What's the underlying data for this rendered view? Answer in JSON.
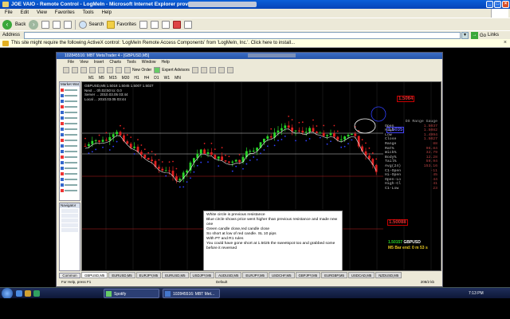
{
  "ie": {
    "title": "JOE VAIO - Remote Control - LogMeIn - Microsoft Internet Explorer provided by",
    "menu": [
      "File",
      "Edit",
      "View",
      "Favorites",
      "Tools",
      "Help"
    ],
    "toolbar": {
      "back": "Back",
      "search": "Search",
      "favorites": "Favorites"
    },
    "address_label": "Address",
    "go_label": "Go",
    "links_label": "Links",
    "infobar": "This site might require the following ActiveX control: 'LogMeIn Remote Access Components' from 'LogMeIn, Inc.'. Click here to install..."
  },
  "mt4": {
    "title": "102845516: MBT MetaTrader 4 - [GBPUSD,M5]",
    "menu": [
      "File",
      "View",
      "Insert",
      "Charts",
      "Tools",
      "Window",
      "Help"
    ],
    "toolbar": {
      "new_order": "New Order",
      "expert_advisors": "Expert Advisors"
    },
    "timeframes": [
      "M1",
      "M5",
      "M15",
      "M30",
      "H1",
      "H4",
      "D1",
      "W1",
      "MN"
    ],
    "market_watch": "Market Wat",
    "navigator": "Navigator",
    "common": "Common",
    "chart_overlay": [
      "GBPUSD,M5 1.5018 1.5045 1.5007 1.5027",
      "Next ...  0h:02:50 to: 0.0",
      "Server ... 2010.03.05 03:44",
      "Local ... 2010.03.05 03:44"
    ],
    "panel": {
      "title": "DS Range Gauge",
      "rows": [
        {
          "k": "Open",
          "v": "1.5037"
        },
        {
          "k": "High",
          "v": "1.5082"
        },
        {
          "k": "Low",
          "v": "1.4994"
        },
        {
          "k": "Close",
          "v": "1.5027"
        },
        {
          "k": "Range",
          "v": "88"
        },
        {
          "k": "Rat%",
          "v": "96.84"
        },
        {
          "k": "Wick%",
          "v": "32.79"
        },
        {
          "k": "Body%",
          "v": "12.28"
        },
        {
          "k": "Tail%",
          "v": "59.94"
        },
        {
          "k": "Avg(24)",
          "v": "153.16"
        },
        {
          "k": "C1-Open",
          "v": "-11"
        },
        {
          "k": "Hi-Open",
          "v": "45"
        },
        {
          "k": "Open-Lo",
          "v": "44"
        },
        {
          "k": "High-Cl",
          "v": "41"
        },
        {
          "k": "C1-Low",
          "v": "23"
        }
      ]
    },
    "level_high": "1.5064",
    "level_mid": "1.5035",
    "level_low": "1.50088",
    "pair_label": "GBPUSD",
    "pair_price": "1.50157",
    "bar_info": "M5 Bar end: 0 m 53 s",
    "note": [
      "White circle is previous resistance",
      "Blue circle shows price went higher than previous resistance and made new one",
      "Green candle close,red candle close",
      "So short at low of red candle. SL 10 pips",
      "With PT and R1 rules",
      "You could have gone short at 1.5025 the sweetspot too and grabbed some before it reversed"
    ],
    "tabs": [
      "GBPUSD,M5",
      "EURUSD,M5",
      "EURJPY,M5",
      "EURUSD,M5",
      "USDJPY,M5",
      "AUDUSD,M5",
      "EURJPY,M5",
      "USDCHF,M5",
      "GBPJPY,M5",
      "EURGBP,M5",
      "USDCAD,M5",
      "NZDUSD,M5"
    ],
    "status": {
      "help": "For Help, press F1",
      "profile": "Default",
      "traffic": "208/2 kb"
    }
  },
  "taskbar": {
    "items": [
      "Spotify",
      "102845516: MBT Met..."
    ],
    "time": "7:13 PM"
  },
  "colors": {
    "bull": "#29d629",
    "bear": "#e02020",
    "sar": "#e02020",
    "sar_low": "#3040ff"
  }
}
